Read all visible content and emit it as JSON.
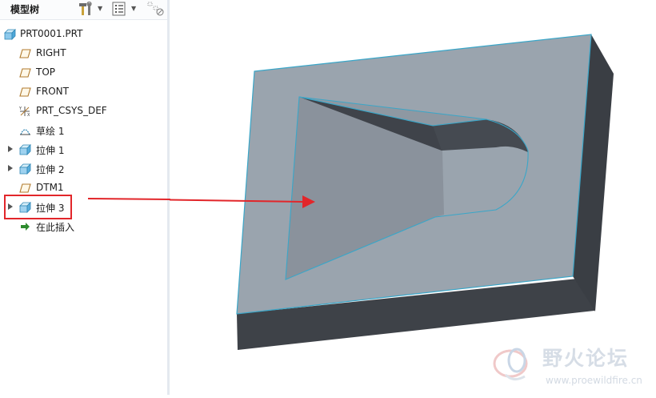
{
  "panel": {
    "title": "模型树",
    "toolbar_icons": [
      "hammer-wrench-icon",
      "tree-list-icon",
      "tree-filter-icon"
    ]
  },
  "tree": {
    "root": {
      "label": "PRT0001.PRT",
      "icon": "part-icon"
    },
    "items": [
      {
        "label": "RIGHT",
        "icon": "datum-plane-icon",
        "expandable": false
      },
      {
        "label": "TOP",
        "icon": "datum-plane-icon",
        "expandable": false
      },
      {
        "label": "FRONT",
        "icon": "datum-plane-icon",
        "expandable": false
      },
      {
        "label": "PRT_CSYS_DEF",
        "icon": "coordinate-system-icon",
        "expandable": false
      },
      {
        "label": "草绘 1",
        "icon": "sketch-icon",
        "expandable": false
      },
      {
        "label": "拉伸 1",
        "icon": "extrude-icon",
        "expandable": true
      },
      {
        "label": "拉伸 2",
        "icon": "extrude-icon",
        "expandable": true
      },
      {
        "label": "DTM1",
        "icon": "datum-plane-icon",
        "expandable": false
      },
      {
        "label": "拉伸 3",
        "icon": "extrude-icon",
        "expandable": true,
        "highlighted": true
      },
      {
        "label": "在此插入",
        "icon": "insert-here-arrow-icon",
        "expandable": false
      }
    ]
  },
  "colors": {
    "annotation": "#e2262a",
    "model_top": "#9aa4ae",
    "model_side": "#3e4248",
    "model_edge": "#3aa6c8"
  },
  "watermark": {
    "text_cn": "野火论坛",
    "url": "www.proewildfire.cn"
  }
}
